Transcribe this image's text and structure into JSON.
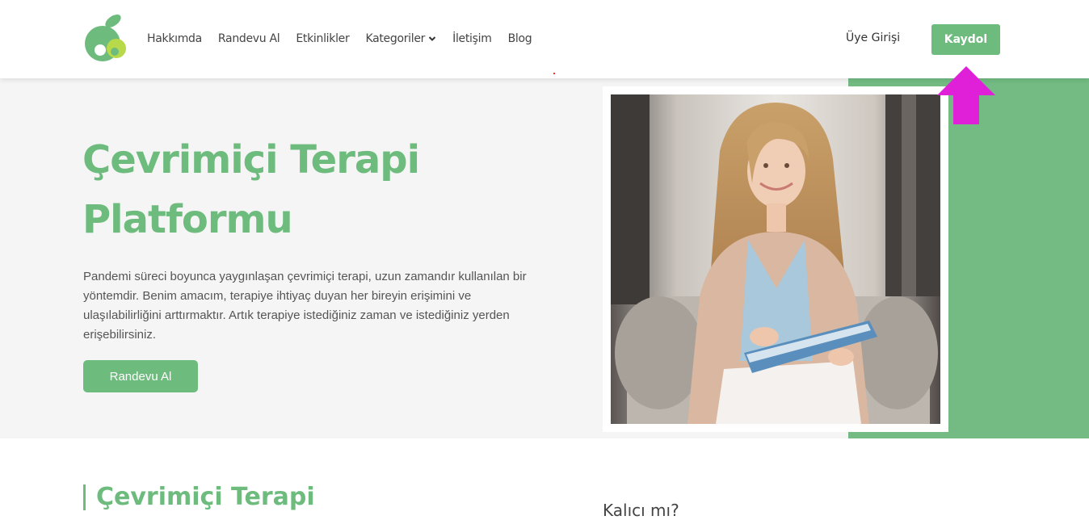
{
  "header": {
    "nav": [
      {
        "label": "Hakkımda"
      },
      {
        "label": "Randevu Al"
      },
      {
        "label": "Etkinlikler"
      },
      {
        "label": "Kategoriler"
      },
      {
        "label": "İletişim"
      },
      {
        "label": "Blog"
      }
    ],
    "login_label": "Üye Girişi",
    "signup_label": "Kaydol"
  },
  "hero": {
    "title": "Çevrimiçi Terapi Platformu",
    "description": "Pandemi süreci boyunca yaygınlaşan çevrimiçi terapi, uzun zamandır kullanılan bir yöntemdir. Benim amacım, terapiye ihtiyaç duyan her bireyin erişimini ve ulaşılabilirliğini arttırmaktır. Artık terapiye istediğiniz zaman ve istediğiniz yerden erişebilirsiniz.",
    "button_label": "Randevu Al"
  },
  "section": {
    "title": "Çevrimiçi Terapi",
    "side_title": "Kalıcı mı?"
  },
  "colors": {
    "brand_green": "#6dbb7d",
    "block_green": "#73bb83",
    "arrow_magenta": "#e020d8"
  },
  "icons": {
    "logo": "leaf-apple-logo",
    "kategoriler_chevron": "chevron-down-icon",
    "annotation": "arrow-up-icon"
  }
}
